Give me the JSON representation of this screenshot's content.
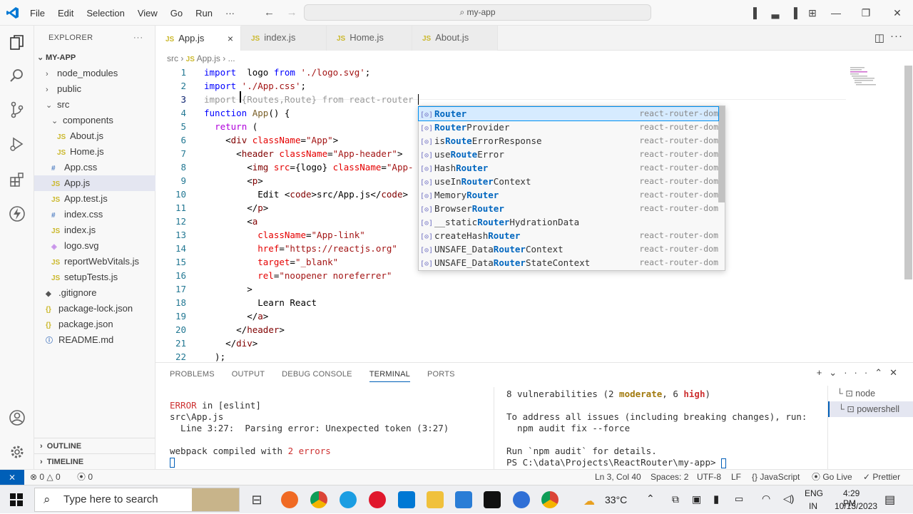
{
  "titlebar": {
    "menus": [
      "File",
      "Edit",
      "Selection",
      "View",
      "Go",
      "Run",
      "···"
    ],
    "search": "my-app"
  },
  "sidebar": {
    "header": "EXPLORER",
    "more": "···",
    "project": "MY-APP",
    "items": [
      {
        "label": "node_modules",
        "type": "folder",
        "open": false,
        "depth": 1
      },
      {
        "label": "public",
        "type": "folder",
        "open": false,
        "depth": 1
      },
      {
        "label": "src",
        "type": "folder",
        "open": true,
        "depth": 1
      },
      {
        "label": "components",
        "type": "folder",
        "open": true,
        "depth": 2
      },
      {
        "label": "About.js",
        "type": "js",
        "depth": 3
      },
      {
        "label": "Home.js",
        "type": "js",
        "depth": 3
      },
      {
        "label": "App.css",
        "type": "css",
        "depth": 2
      },
      {
        "label": "App.js",
        "type": "js",
        "depth": 2,
        "selected": true
      },
      {
        "label": "App.test.js",
        "type": "js",
        "depth": 2
      },
      {
        "label": "index.css",
        "type": "css",
        "depth": 2
      },
      {
        "label": "index.js",
        "type": "js",
        "depth": 2
      },
      {
        "label": "logo.svg",
        "type": "svg",
        "depth": 2
      },
      {
        "label": "reportWebVitals.js",
        "type": "js",
        "depth": 2
      },
      {
        "label": "setupTests.js",
        "type": "js",
        "depth": 2
      },
      {
        "label": ".gitignore",
        "type": "git",
        "depth": 1
      },
      {
        "label": "package-lock.json",
        "type": "json",
        "depth": 1
      },
      {
        "label": "package.json",
        "type": "json",
        "depth": 1
      },
      {
        "label": "README.md",
        "type": "info",
        "depth": 1
      }
    ],
    "outline": "OUTLINE",
    "timeline": "TIMELINE"
  },
  "tabs": [
    {
      "label": "App.js",
      "active": true
    },
    {
      "label": "index.js"
    },
    {
      "label": "Home.js"
    },
    {
      "label": "About.js"
    }
  ],
  "breadcrumb": {
    "folder": "src",
    "file": "App.js",
    "rest": "..."
  },
  "editor": {
    "line_numbers": [
      "1",
      "2",
      "3",
      "4",
      "5",
      "6",
      "7",
      "8",
      "9",
      "10",
      "11",
      "12",
      "13",
      "14",
      "15",
      "16",
      "17",
      "18",
      "19",
      "20",
      "21",
      "22"
    ],
    "current_line": 3,
    "lines": [
      [
        [
          "k",
          "import"
        ],
        [
          "",
          "  logo "
        ],
        [
          "k",
          "from"
        ],
        [
          "s",
          " './logo.svg'"
        ],
        [
          "",
          ";"
        ]
      ],
      [
        [
          "k",
          "import"
        ],
        [
          "s",
          " './App.css'"
        ],
        [
          "",
          ";"
        ]
      ],
      [
        [
          "g",
          "import {Routes,Route} from react-router"
        ]
      ],
      [
        [
          "k",
          "function"
        ],
        [
          "fn",
          " App"
        ],
        [
          "",
          "() {"
        ]
      ],
      [
        [
          "",
          "  "
        ],
        [
          "kw",
          "return"
        ],
        [
          "",
          " ("
        ]
      ],
      [
        [
          "",
          "    <"
        ],
        [
          "t",
          "div"
        ],
        [
          "a",
          " className"
        ],
        [
          "",
          "="
        ],
        [
          "s",
          "\"App\""
        ],
        [
          "",
          ">"
        ]
      ],
      [
        [
          "",
          "      <"
        ],
        [
          "t",
          "header"
        ],
        [
          "a",
          " className"
        ],
        [
          "",
          "="
        ],
        [
          "s",
          "\"App-header\""
        ],
        [
          "",
          ">"
        ]
      ],
      [
        [
          "",
          "        <"
        ],
        [
          "t",
          "img"
        ],
        [
          "a",
          " src"
        ],
        [
          "",
          "={logo} "
        ],
        [
          "a",
          "className"
        ],
        [
          "",
          "="
        ],
        [
          "s",
          "\"App-"
        ]
      ],
      [
        [
          "",
          "        <"
        ],
        [
          "t",
          "p"
        ],
        [
          "",
          ">"
        ]
      ],
      [
        [
          "",
          "          Edit <"
        ],
        [
          "t",
          "code"
        ],
        [
          "",
          ">src/App.js</"
        ],
        [
          "t",
          "code"
        ],
        [
          "",
          ">"
        ]
      ],
      [
        [
          "",
          "        </"
        ],
        [
          "t",
          "p"
        ],
        [
          "",
          ">"
        ]
      ],
      [
        [
          "",
          "        <"
        ],
        [
          "t",
          "a"
        ]
      ],
      [
        [
          "a",
          "          className"
        ],
        [
          "",
          "="
        ],
        [
          "s",
          "\"App-link\""
        ]
      ],
      [
        [
          "a",
          "          href"
        ],
        [
          "",
          "="
        ],
        [
          "s",
          "\"https://reactjs.org\""
        ]
      ],
      [
        [
          "a",
          "          target"
        ],
        [
          "",
          "="
        ],
        [
          "s",
          "\"_blank\""
        ]
      ],
      [
        [
          "a",
          "          rel"
        ],
        [
          "",
          "="
        ],
        [
          "s",
          "\"noopener noreferrer\""
        ]
      ],
      [
        [
          "",
          "        >"
        ]
      ],
      [
        [
          "",
          "          Learn React"
        ]
      ],
      [
        [
          "",
          "        </"
        ],
        [
          "t",
          "a"
        ],
        [
          "",
          ">"
        ]
      ],
      [
        [
          "",
          "      </"
        ],
        [
          "t",
          "header"
        ],
        [
          "",
          ">"
        ]
      ],
      [
        [
          "",
          "    </"
        ],
        [
          "t",
          "div"
        ],
        [
          "",
          ">"
        ]
      ],
      [
        [
          "",
          "  );"
        ]
      ]
    ]
  },
  "suggestions": [
    {
      "pre": "",
      "match": "Router",
      "post": "",
      "source": "react-router-dom",
      "selected": true
    },
    {
      "pre": "",
      "match": "Router",
      "post": "Provider",
      "source": "react-router-dom"
    },
    {
      "pre": "is",
      "match": "Route",
      "post": "ErrorResponse",
      "source": "react-router-dom"
    },
    {
      "pre": "use",
      "match": "Route",
      "post": "Error",
      "source": "react-router-dom"
    },
    {
      "pre": "Hash",
      "match": "Router",
      "post": "",
      "source": "react-router-dom"
    },
    {
      "pre": "useIn",
      "match": "Router",
      "post": "Context",
      "source": "react-router-dom"
    },
    {
      "pre": "Memory",
      "match": "Router",
      "post": "",
      "source": "react-router-dom"
    },
    {
      "pre": "Browser",
      "match": "Router",
      "post": "",
      "source": "react-router-dom"
    },
    {
      "pre": "__static",
      "match": "Router",
      "post": "HydrationData",
      "source": ""
    },
    {
      "pre": "createHash",
      "match": "Router",
      "post": "",
      "source": "react-router-dom"
    },
    {
      "pre": "UNSAFE_Data",
      "match": "Router",
      "post": "Context",
      "source": "react-router-dom"
    },
    {
      "pre": "UNSAFE_Data",
      "match": "Router",
      "post": "StateContext",
      "source": "react-router-dom"
    }
  ],
  "panel": {
    "tabs": [
      "PROBLEMS",
      "OUTPUT",
      "DEBUG CONSOLE",
      "TERMINAL",
      "PORTS"
    ],
    "active_tab": "TERMINAL",
    "left": {
      "error_label": "ERROR",
      "error_rest": " in [eslint]",
      "file": "src\\App.js",
      "parse": "  Line 3:27:  Parsing error: Unexpected token (3:27)",
      "compiled_pre": "webpack compiled with ",
      "compiled_err": "2 errors"
    },
    "right": {
      "vuln_pre": "8 vulnerabilities (2 ",
      "moderate": "moderate",
      "vuln_mid": ", 6 ",
      "high": "high",
      "vuln_post": ")",
      "line2": "To address all issues (including breaking changes), run:",
      "line3": "  npm audit fix --force",
      "line4": "Run `npm audit` for details.",
      "prompt": "PS C:\\data\\Projects\\ReactRouter\\my-app> "
    },
    "terminals": [
      "node",
      "powershell"
    ]
  },
  "statusbar": {
    "errors": "0",
    "warnings": "0",
    "ports": "0",
    "position": "Ln 3, Col 40",
    "spaces": "Spaces: 2",
    "encoding": "UTF-8",
    "eol": "LF",
    "language": "JavaScript",
    "golive": "Go Live",
    "prettier": "Prettier"
  },
  "taskbar": {
    "search": "Type here to search",
    "temp": "33°C",
    "lang1": "ENG",
    "lang2": "IN",
    "time": "4:29 PM",
    "date": "10/13/2023"
  },
  "colors": {
    "accent": "#005fb8",
    "js": "#cbb82c",
    "css": "#4f7ec2"
  }
}
